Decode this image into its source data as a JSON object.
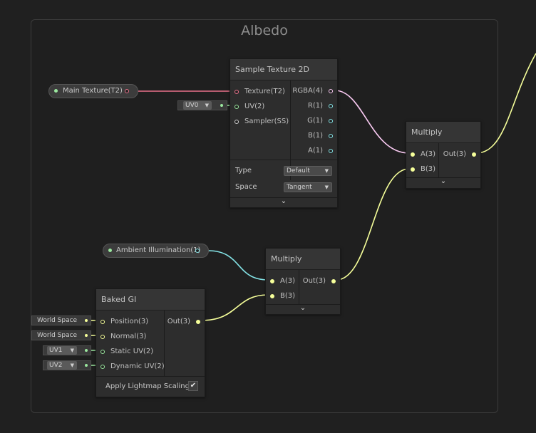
{
  "group": {
    "title": "Albedo"
  },
  "properties": {
    "main_texture": "Main Texture(T2)",
    "ambient": "Ambient Illumination(1)"
  },
  "sample_texture": {
    "title": "Sample Texture 2D",
    "inputs": [
      "Texture(T2)",
      "UV(2)",
      "Sampler(SS)"
    ],
    "outputs": [
      "RGBA(4)",
      "R(1)",
      "G(1)",
      "B(1)",
      "A(1)"
    ],
    "type_label": "Type",
    "type_value": "Default",
    "space_label": "Space",
    "space_value": "Tangent",
    "uv_field": "UV0"
  },
  "multiply_top": {
    "title": "Multiply",
    "inputs": [
      "A(3)",
      "B(3)"
    ],
    "output": "Out(3)"
  },
  "multiply_mid": {
    "title": "Multiply",
    "inputs": [
      "A(3)",
      "B(3)"
    ],
    "output": "Out(3)"
  },
  "baked_gi": {
    "title": "Baked GI",
    "inputs": [
      "Position(3)",
      "Normal(3)",
      "Static UV(2)",
      "Dynamic UV(2)"
    ],
    "output": "Out(3)",
    "fields": [
      "World Space",
      "World Space",
      "UV1",
      "UV2"
    ],
    "lightmap_label": "Apply Lightmap Scaling",
    "lightmap_checked": "✔"
  },
  "icons": {
    "chevron": "⌄",
    "dropdown_arrow": "▼"
  },
  "colors": {
    "texture_port": "#e8718a",
    "vector2": "#9be89f",
    "vector1": "#84e4e7",
    "vector3": "#f6ff9a",
    "vector4": "#fbcbf4",
    "sampler": "#cfcfcf"
  }
}
